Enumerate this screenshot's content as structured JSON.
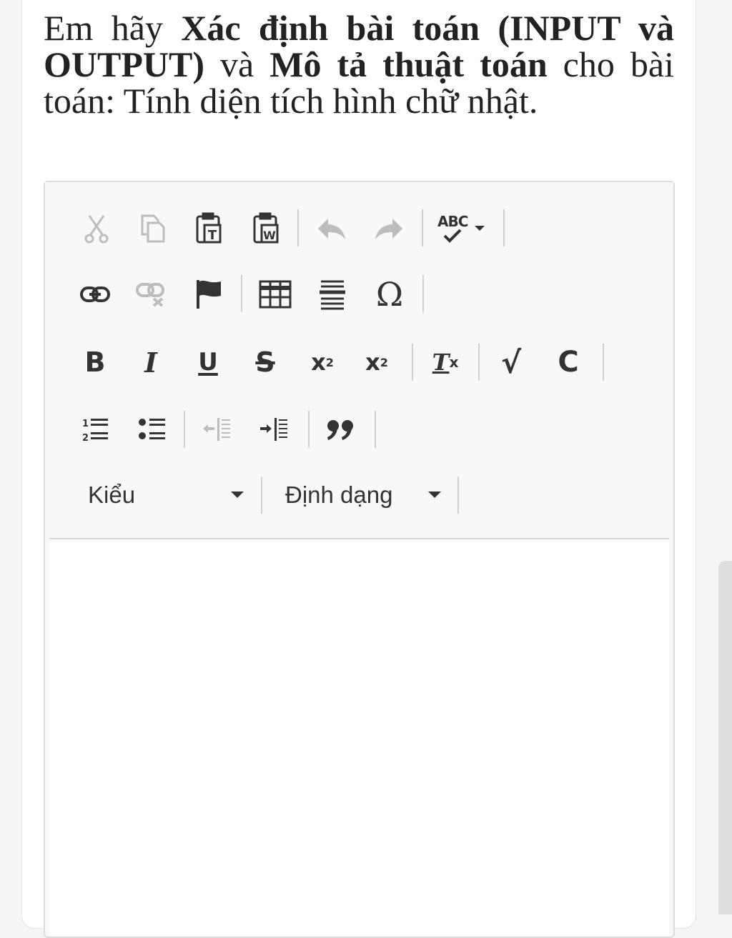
{
  "question": {
    "part1": " Em hãy ",
    "bold1": "Xác định bài toán (INPUT và OUTPUT)",
    "part2": " và ",
    "bold2": "Mô tả thuật toán",
    "part3": " cho bài toán: Tính diện tích hình chữ nhật."
  },
  "toolbar": {
    "row1": [
      "cut-icon",
      "copy-icon",
      "paste-text-icon",
      "paste-word-icon",
      "undo-icon",
      "redo-icon",
      "spellcheck-icon"
    ],
    "spellcheck_label": "ABC",
    "row2": [
      "link-icon",
      "unlink-icon",
      "anchor-icon",
      "table-icon",
      "horizontal-line-icon",
      "special-char-icon"
    ],
    "special_char_glyph": "Ω",
    "row3": {
      "bold": "B",
      "italic": "I",
      "underline": "U",
      "strike": "S",
      "subscript_base": "x",
      "subscript_sup": "2",
      "superscript_base": "x",
      "superscript_sup": "2",
      "remove_format": "T",
      "remove_format_sub": "x",
      "math": "√",
      "chem": "C"
    },
    "row4": [
      "numbered-list-icon",
      "bulleted-list-icon",
      "outdent-icon",
      "indent-icon",
      "blockquote-icon"
    ],
    "styles_label": "Kiểu",
    "format_label": "Định dạng"
  },
  "editor": {
    "content": ""
  }
}
